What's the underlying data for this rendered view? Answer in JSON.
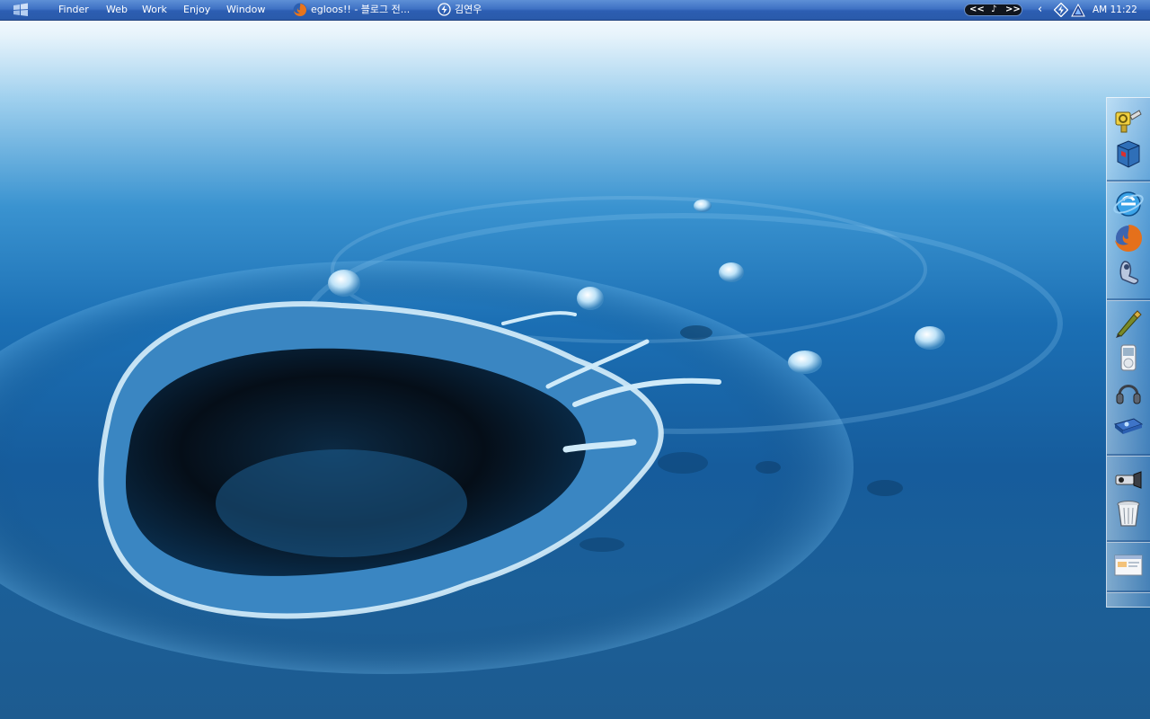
{
  "menubar": {
    "start_logo_icon": "windows-flag-icon",
    "menus": [
      "Finder",
      "Web",
      "Work",
      "Enjoy",
      "Window"
    ],
    "tasks": [
      {
        "icon": "firefox-icon",
        "label": "egloos!! - 블로그 전..."
      },
      {
        "icon": "lightning-app-icon",
        "label": "김연우"
      }
    ],
    "media": {
      "prev": "<<",
      "note": "♪",
      "next": ">>"
    },
    "tray": {
      "arrow": "‹",
      "icons": [
        "lightning-tray-icon",
        "network-tray-icon"
      ]
    },
    "clock": "AM 11:22"
  },
  "dock": {
    "icons": [
      "usb-key-icon",
      "cube-box-icon",
      "internet-explorer-icon",
      "firefox-icon",
      "messenger-icon",
      "pen-tool-icon",
      "ipod-icon",
      "headphones-icon",
      "media-drive-icon",
      "camera-lens-icon",
      "trash-icon",
      "window-thumbnail-icon"
    ]
  },
  "colors": {
    "menubar": "#3f72c4",
    "water_deep": "#165c9c",
    "water_light": "#9fd0ee"
  }
}
